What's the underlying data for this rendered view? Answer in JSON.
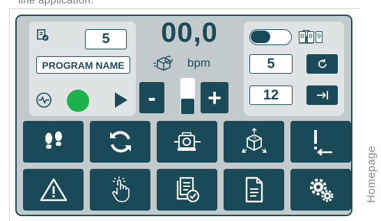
{
  "caption": "line application.",
  "side_label": "Homepage",
  "program": {
    "number": "5",
    "name": "PROGRAM NAME"
  },
  "speed": {
    "value": "00,0",
    "unit": "bpm"
  },
  "controls": {
    "minus": "-",
    "plus": "+",
    "toggle_on": true
  },
  "counter": {
    "digits": [
      "0",
      "0",
      "9"
    ]
  },
  "right": {
    "value1": "5",
    "value2": "12",
    "reset_icon": "refresh-icon",
    "goto_icon": "arrow-to-end-icon"
  },
  "tiles": [
    {
      "name": "tile-footsteps",
      "icon": "footsteps-icon"
    },
    {
      "name": "tile-cycle",
      "icon": "refresh-cycle-icon"
    },
    {
      "name": "tile-motor",
      "icon": "motor-icon"
    },
    {
      "name": "tile-box-size",
      "icon": "box-question-icon"
    },
    {
      "name": "tile-jog-end",
      "icon": "jog-end-icon"
    },
    {
      "name": "tile-alarms",
      "icon": "warning-triangle-icon"
    },
    {
      "name": "tile-manual",
      "icon": "touch-hand-icon"
    },
    {
      "name": "tile-recipes",
      "icon": "document-check-icon"
    },
    {
      "name": "tile-document",
      "icon": "document-icon"
    },
    {
      "name": "tile-settings",
      "icon": "gears-icon"
    }
  ],
  "colors": {
    "primary": "#1a4a58",
    "panel": "#dfe3e4",
    "screen": "#c3cacc",
    "running": "#1db14a"
  }
}
